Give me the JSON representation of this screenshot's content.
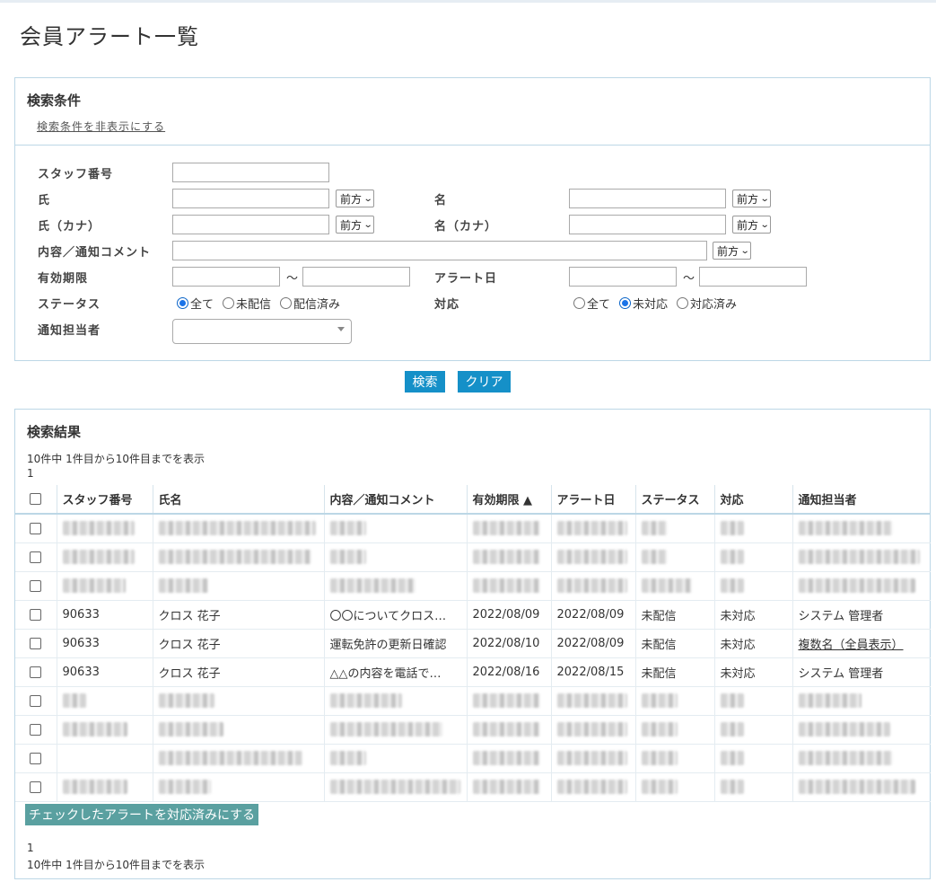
{
  "page": {
    "title": "会員アラート一覧"
  },
  "search": {
    "heading": "検索条件",
    "toggle_link": "検索条件を非表示にする",
    "labels": {
      "staff_no": "スタッフ番号",
      "last_name": "氏",
      "first_name": "名",
      "last_name_kana": "氏（カナ）",
      "first_name_kana": "名（カナ）",
      "content": "内容／通知コメント",
      "expiry": "有効期限",
      "alert_date": "アラート日",
      "status": "ステータス",
      "response": "対応",
      "assignee": "通知担当者"
    },
    "match_option": "前方",
    "range_separator": "～",
    "status_options": [
      {
        "label": "全て",
        "checked": true
      },
      {
        "label": "未配信",
        "checked": false
      },
      {
        "label": "配信済み",
        "checked": false
      }
    ],
    "response_options": [
      {
        "label": "全て",
        "checked": false
      },
      {
        "label": "未対応",
        "checked": true
      },
      {
        "label": "対応済み",
        "checked": false
      }
    ],
    "search_button": "検索",
    "clear_button": "クリア"
  },
  "results": {
    "heading": "検索結果",
    "summary": "10件中 1件目から10件目までを表示",
    "page_number": "1",
    "columns": [
      "スタッフ番号",
      "氏名",
      "内容／通知コメント",
      "有効期限 ▲",
      "アラート日",
      "ステータス",
      "対応",
      "通知担当者"
    ],
    "visible_rows": [
      {
        "staff_no": "90633",
        "name": "クロス 花子",
        "content": "〇〇についてクロス…",
        "expiry": "2022/08/09",
        "alert_date": "2022/08/09",
        "status": "未配信",
        "response": "未対応",
        "assignee": "システム 管理者",
        "assignee_link": false
      },
      {
        "staff_no": "90633",
        "name": "クロス 花子",
        "content": "運転免許の更新日確認",
        "expiry": "2022/08/10",
        "alert_date": "2022/08/09",
        "status": "未配信",
        "response": "未対応",
        "assignee": "複数名（全員表示）",
        "assignee_link": true
      },
      {
        "staff_no": "90633",
        "name": "クロス 花子",
        "content": "△△の内容を電話で…",
        "expiry": "2022/08/16",
        "alert_date": "2022/08/15",
        "status": "未配信",
        "response": "未対応",
        "assignee": "システム 管理者",
        "assignee_link": false
      }
    ],
    "bulk_button": "チェックしたアラートを対応済みにする"
  }
}
